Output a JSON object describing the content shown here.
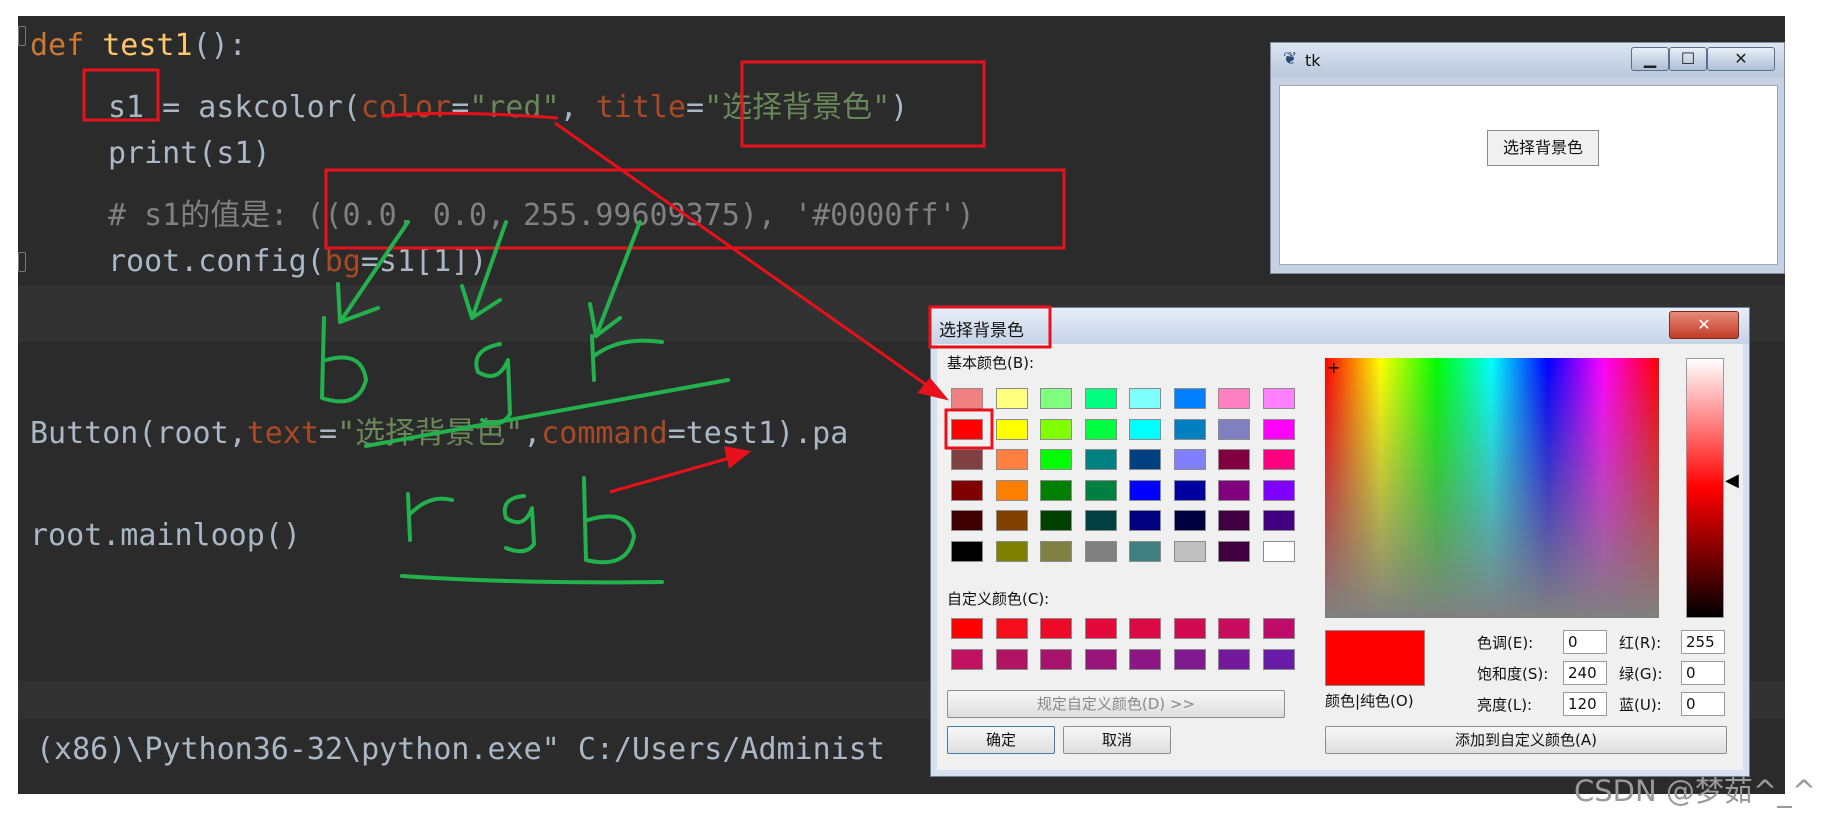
{
  "editor": {
    "line_def": {
      "kw": "def",
      "name": "test1",
      "rest": "():"
    },
    "line_s1": {
      "var": "s1",
      "op": " = askcolor(",
      "p1": "color",
      "eq1": "=",
      "v1": "\"red\"",
      "comma": ", ",
      "p2": "title",
      "eq2": "=",
      "v2": "\"选择背景色\"",
      "close": ")"
    },
    "line_print": "print(s1)",
    "line_comment": "# s1的值是: ((0.0, 0.0, 255.99609375), '#0000ff')",
    "line_config": {
      "pre": "root.config(",
      "p": "bg",
      "post": "=s1[1])"
    },
    "line_button": {
      "pre": "Button(root,",
      "p1": "text",
      "eq1": "=",
      "v1": "\"选择背景色\"",
      "comma": ",",
      "p2": "command",
      "post": "=test1).pa"
    },
    "line_mainloop": "root.mainloop()",
    "console_line": "(x86)\\Python36-32\\python.exe\" C:/Users/Administ"
  },
  "tk_window": {
    "title": "tk",
    "minimize": "▁",
    "maximize": "☐",
    "close": "✕",
    "button_label": "选择背景色"
  },
  "color_dialog": {
    "title": "选择背景色",
    "close": "✕",
    "basic_colors_label": "基本颜色(B):",
    "basic_colors": [
      [
        "#f08080",
        "#ffff80",
        "#80ff80",
        "#00ff80",
        "#80ffff",
        "#0080ff",
        "#ff80c0",
        "#ff80ff"
      ],
      [
        "#ff0000",
        "#ffff00",
        "#80ff00",
        "#00ff40",
        "#00ffff",
        "#0080c0",
        "#8080c0",
        "#ff00ff"
      ],
      [
        "#804040",
        "#ff8040",
        "#00ff00",
        "#008080",
        "#004080",
        "#8080ff",
        "#800040",
        "#ff0080"
      ],
      [
        "#800000",
        "#ff8000",
        "#008000",
        "#008040",
        "#0000ff",
        "#0000a0",
        "#800080",
        "#8000ff"
      ],
      [
        "#400000",
        "#804000",
        "#004000",
        "#004040",
        "#000080",
        "#000040",
        "#400040",
        "#400080"
      ],
      [
        "#000000",
        "#808000",
        "#808040",
        "#808080",
        "#408080",
        "#c0c0c0",
        "#400040",
        "#ffffff"
      ]
    ],
    "custom_colors_label": "自定义颜色(C):",
    "custom_colors": [
      [
        "#ff0000",
        "#f70d1a",
        "#ee0a26",
        "#e5083a",
        "#dc0a44",
        "#d20b50",
        "#c90d5e",
        "#bf0c6a"
      ],
      [
        "#c0125e",
        "#b21464",
        "#a5136d",
        "#991478",
        "#8c1684",
        "#801890",
        "#74199c",
        "#681aa8"
      ]
    ],
    "define_custom_button": "规定自定义颜色(D) >>",
    "ok_button": "确定",
    "cancel_button": "取消",
    "preview_color": "#ff0000",
    "preview_label": "颜色|纯色(O)",
    "hue_label": "色调(E):",
    "hue_value": "0",
    "sat_label": "饱和度(S):",
    "sat_value": "240",
    "lum_label": "亮度(L):",
    "lum_value": "120",
    "red_label": "红(R):",
    "red_value": "255",
    "green_label": "绿(G):",
    "green_value": "0",
    "blue_label": "蓝(U):",
    "blue_value": "0",
    "add_custom_button": "添加到自定义颜色(A)"
  },
  "annotations": {
    "letters_top": [
      "b",
      "g",
      "r"
    ],
    "letters_bottom": [
      "r",
      "g",
      "b"
    ],
    "highlight_color": "#e8101a",
    "handwriting_color": "#22b14c"
  },
  "watermark": "CSDN @梦茹^_^"
}
